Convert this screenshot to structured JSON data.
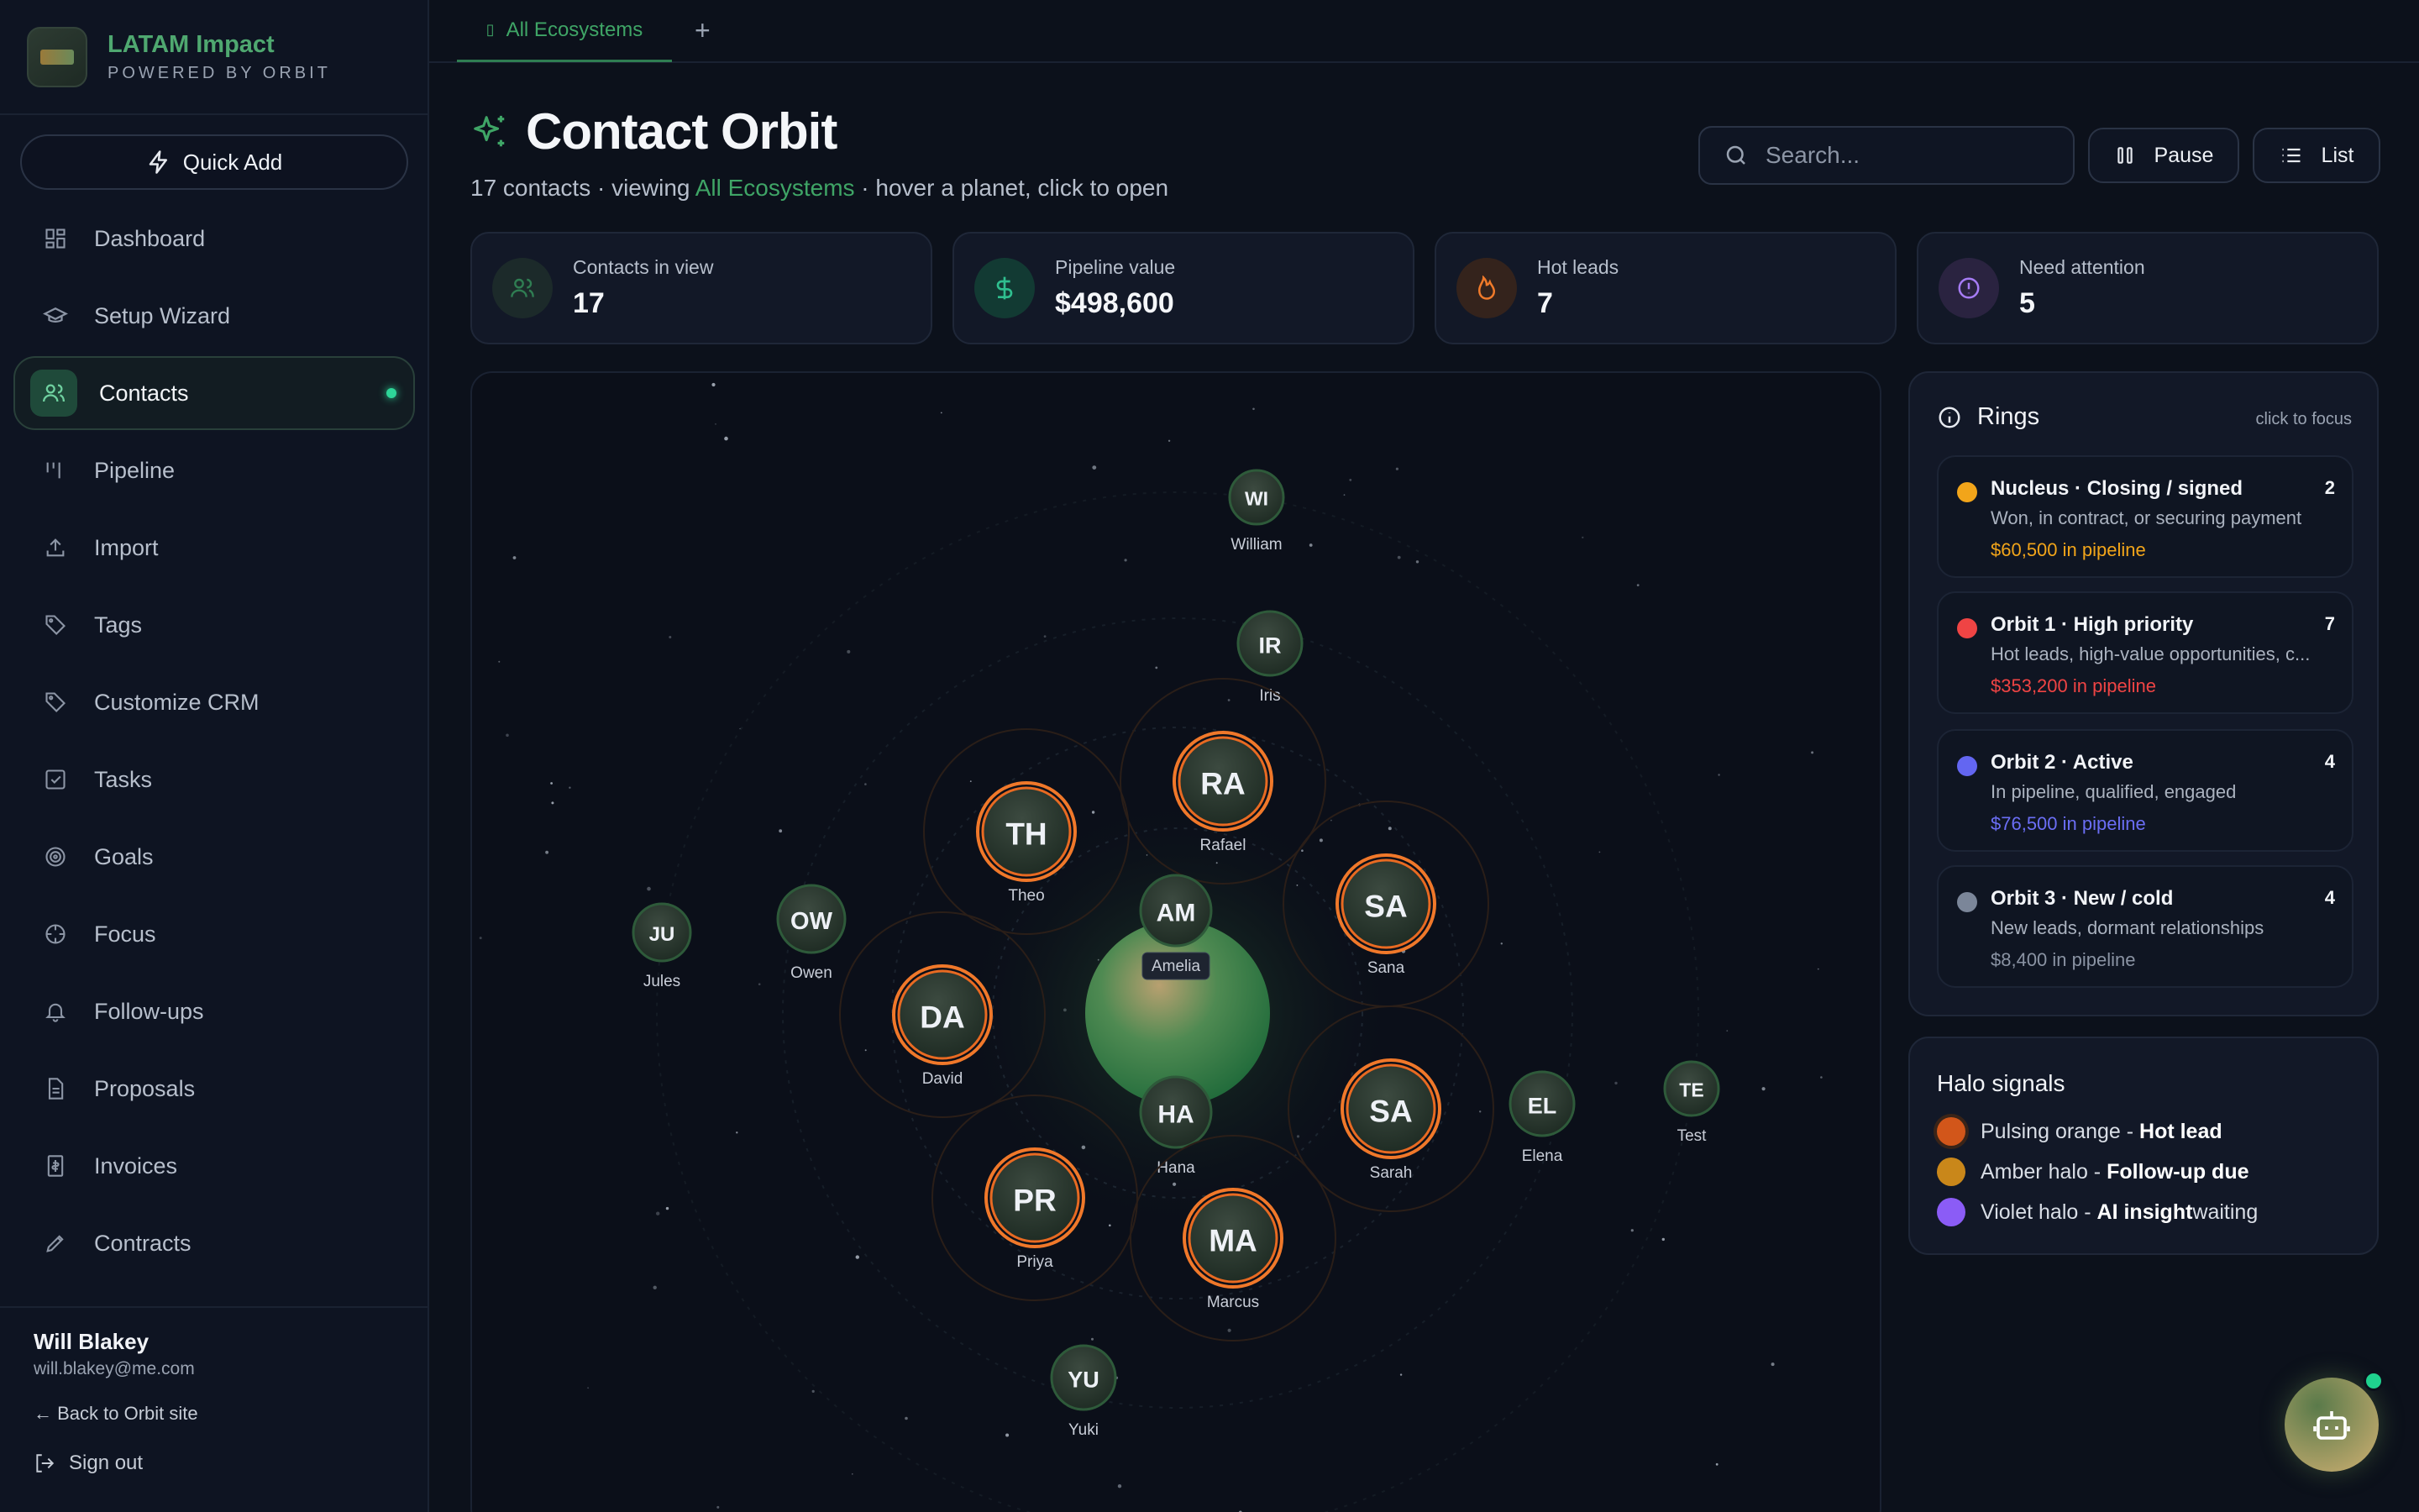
{
  "brand": {
    "title": "LATAM Impact",
    "subtitle": "POWERED BY ORBIT"
  },
  "quick_add": "Quick Add",
  "nav": [
    {
      "label": "Dashboard",
      "icon": "dashboard-icon"
    },
    {
      "label": "Setup Wizard",
      "icon": "graduation-cap-icon"
    },
    {
      "label": "Contacts",
      "icon": "users-icon",
      "active": true
    },
    {
      "label": "Pipeline",
      "icon": "kanban-icon"
    },
    {
      "label": "Import",
      "icon": "upload-icon"
    },
    {
      "label": "Tags",
      "icon": "tag-icon"
    },
    {
      "label": "Customize CRM",
      "icon": "tag-icon"
    },
    {
      "label": "Tasks",
      "icon": "checkbox-icon"
    },
    {
      "label": "Goals",
      "icon": "target-icon"
    },
    {
      "label": "Focus",
      "icon": "crosshair-icon"
    },
    {
      "label": "Follow-ups",
      "icon": "bell-icon"
    },
    {
      "label": "Proposals",
      "icon": "document-icon"
    },
    {
      "label": "Invoices",
      "icon": "invoice-icon"
    },
    {
      "label": "Contracts",
      "icon": "signature-icon"
    }
  ],
  "user": {
    "name": "Will Blakey",
    "email": "will.blakey@me.com",
    "back": "← Back to Orbit site",
    "signout": "Sign out"
  },
  "tabs": {
    "active": "All Ecosystems",
    "add": "+"
  },
  "header": {
    "title": "Contact Orbit",
    "sub_a": "17 contacts · viewing ",
    "sub_accent": "All Ecosystems",
    "sub_b": " · hover a planet, click to open"
  },
  "search": {
    "placeholder": "Search..."
  },
  "buttons": {
    "pause": "Pause",
    "list": "List"
  },
  "stats": [
    {
      "label": "Contacts in view",
      "value": "17",
      "icon": "users-icon",
      "color": "#2b3b3a"
    },
    {
      "label": "Pipeline value",
      "value": "$498,600",
      "icon": "dollar-icon",
      "color": "#173a33"
    },
    {
      "label": "Hot leads",
      "value": "7",
      "icon": "flame-icon",
      "color": "#3a2720"
    },
    {
      "label": "Need attention",
      "value": "5",
      "icon": "alert-circle-icon",
      "color": "#2e2540"
    }
  ],
  "planets": [
    {
      "initials": "WI",
      "name": "William",
      "halo": "none"
    },
    {
      "initials": "IR",
      "name": "Iris",
      "halo": "none"
    },
    {
      "initials": "RA",
      "name": "Rafael",
      "halo": "hot"
    },
    {
      "initials": "TH",
      "name": "Theo",
      "halo": "hot"
    },
    {
      "initials": "SA",
      "name": "Sana",
      "halo": "hot"
    },
    {
      "initials": "AM",
      "name": "Amelia",
      "halo": "none",
      "highlight": true
    },
    {
      "initials": "OW",
      "name": "Owen",
      "halo": "none"
    },
    {
      "initials": "JU",
      "name": "Jules",
      "halo": "none"
    },
    {
      "initials": "DA",
      "name": "David",
      "halo": "hot"
    },
    {
      "initials": "HA",
      "name": "Hana",
      "halo": "none"
    },
    {
      "initials": "SA",
      "name": "Sarah",
      "halo": "hot"
    },
    {
      "initials": "EL",
      "name": "Elena",
      "halo": "none"
    },
    {
      "initials": "TE",
      "name": "Test",
      "halo": "none"
    },
    {
      "initials": "PR",
      "name": "Priya",
      "halo": "hot"
    },
    {
      "initials": "MA",
      "name": "Marcus",
      "halo": "hot"
    },
    {
      "initials": "YU",
      "name": "Yuki",
      "halo": "none"
    }
  ],
  "rings_panel": {
    "title": "Rings",
    "hint": "click to focus",
    "rings": [
      {
        "name": "Nucleus · Closing / signed",
        "count": "2",
        "desc": "Won, in contract, or securing payment",
        "pipeline": "$60,500 in pipeline",
        "color": "#f2a51a"
      },
      {
        "name": "Orbit 1 · High priority",
        "count": "7",
        "desc": "Hot leads, high-value opportunities, c...",
        "pipeline": "$353,200 in pipeline",
        "color": "#ef4444"
      },
      {
        "name": "Orbit 2 · Active",
        "count": "4",
        "desc": "In pipeline, qualified, engaged",
        "pipeline": "$76,500 in pipeline",
        "color": "#6366f1"
      },
      {
        "name": "Orbit 3 · New / cold",
        "count": "4",
        "desc": "New leads, dormant relationships",
        "pipeline": "$8,400 in pipeline",
        "color": "#7b8699"
      }
    ]
  },
  "halo_panel": {
    "title": "Halo signals",
    "rows": [
      {
        "prefix": "Pulsing orange - ",
        "bold": "Hot lead",
        "suffix": "",
        "color": "#d2561a"
      },
      {
        "prefix": "Amber halo - ",
        "bold": "Follow-up due",
        "suffix": "",
        "color": "#c9871a"
      },
      {
        "prefix": "Violet halo - ",
        "bold": "AI insight",
        "suffix": " waiting",
        "color": "#8b5cf6"
      }
    ]
  }
}
